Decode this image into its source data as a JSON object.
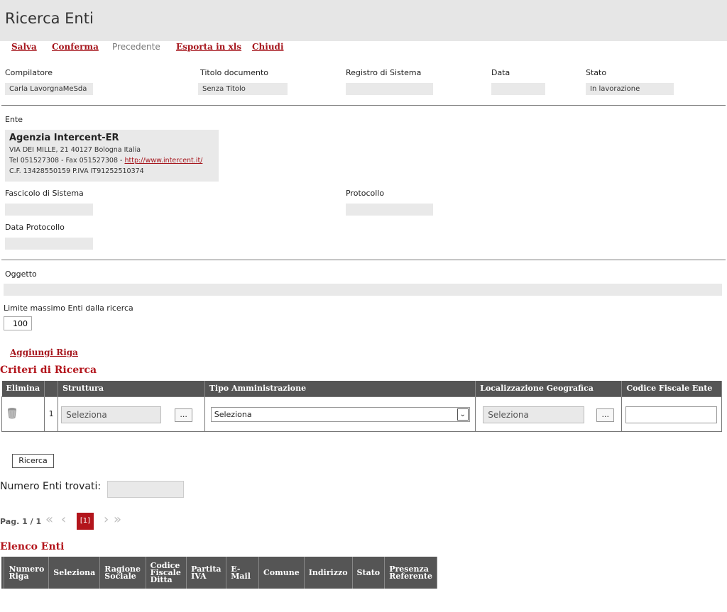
{
  "page": {
    "title": "Ricerca Enti"
  },
  "toolbar": {
    "salva": "Salva",
    "conferma": "Conferma",
    "precedente": "Precedente",
    "esporta": "Esporta in xls",
    "chiudi": "Chiudi"
  },
  "header_fields": {
    "compilatore": {
      "label": "Compilatore",
      "value": "Carla LavorgnaMeSda"
    },
    "titolo": {
      "label": "Titolo documento",
      "value": "Senza Titolo"
    },
    "registro": {
      "label": "Registro di Sistema",
      "value": ""
    },
    "data": {
      "label": "Data",
      "value": ""
    },
    "stato": {
      "label": "Stato",
      "value": "In lavorazione"
    }
  },
  "ente": {
    "label": "Ente",
    "name": "Agenzia Intercent-ER",
    "address": "VIA DEI MILLE, 21 40127 Bologna Italia",
    "contacts_prefix": "Tel 051527308 - Fax 051527308 - ",
    "website": "http://www.intercent.it/",
    "fiscal": "C.F. 13428550159 P.IVA IT91252510374"
  },
  "fascicolo": {
    "label": "Fascicolo di Sistema",
    "value": ""
  },
  "protocollo": {
    "label": "Protocollo",
    "value": ""
  },
  "data_protocollo": {
    "label": "Data Protocollo",
    "value": ""
  },
  "oggetto": {
    "label": "Oggetto",
    "value": ""
  },
  "limite": {
    "label": "Limite massimo Enti dalla ricerca",
    "value": "100"
  },
  "aggiungi_riga": "Aggiungi Riga",
  "criteri": {
    "title": "Criteri di Ricerca",
    "headers": {
      "elimina": "Elimina",
      "num": "",
      "struttura": "Struttura",
      "tipo": "Tipo Amministrazione",
      "localizzazione": "Localizzazione Geografica",
      "codice": "Codice Fiscale Ente"
    },
    "row": {
      "num": "1",
      "struttura": "Seleziona",
      "struttura_btn": "...",
      "tipo": "Seleziona",
      "localizzazione": "Seleziona",
      "localizzazione_btn": "...",
      "codice": ""
    }
  },
  "ricerca_button": "Ricerca",
  "numero_enti": {
    "label": "Numero Enti trovati:",
    "value": ""
  },
  "pagination": {
    "label": "Pag.",
    "current": "1",
    "sep": "/",
    "total": "1",
    "first": "«",
    "prev": "‹",
    "page_badge": "[1]",
    "next": "›",
    "last": "»"
  },
  "elenco": {
    "title": "Elenco Enti",
    "headers": [
      "Numero Riga",
      "Seleziona",
      "Ragione Sociale",
      "Codice Fiscale Ditta",
      "Partita IVA",
      "E-Mail",
      "Comune",
      "Indirizzo",
      "Stato",
      "Presenza Referente"
    ]
  },
  "colors": {
    "accent": "#a6161d",
    "header_bg": "#555555",
    "readonly_bg": "#e9e9e9"
  }
}
